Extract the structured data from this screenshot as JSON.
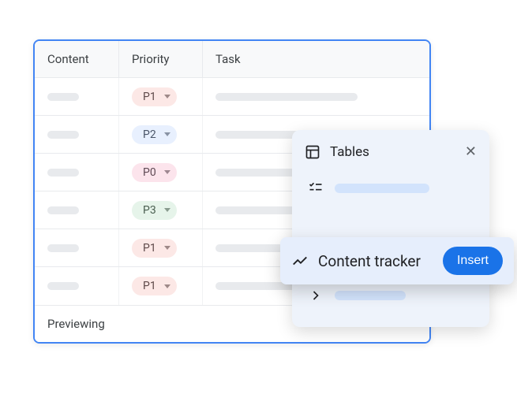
{
  "table": {
    "headers": {
      "content": "Content",
      "priority": "Priority",
      "task": "Task"
    },
    "rows": [
      {
        "priority": "P1",
        "chipClass": "chip-p1",
        "taskLen": "long"
      },
      {
        "priority": "P2",
        "chipClass": "chip-p2",
        "taskLen": "long"
      },
      {
        "priority": "P0",
        "chipClass": "chip-p0",
        "taskLen": "short"
      },
      {
        "priority": "P3",
        "chipClass": "chip-p3",
        "taskLen": "long"
      },
      {
        "priority": "P1",
        "chipClass": "chip-p1",
        "taskLen": "short"
      },
      {
        "priority": "P1",
        "chipClass": "chip-p1",
        "taskLen": "long"
      }
    ],
    "footer": "Previewing"
  },
  "menu": {
    "title": "Tables",
    "highlight": {
      "label": "Content tracker",
      "button": "Insert"
    }
  }
}
